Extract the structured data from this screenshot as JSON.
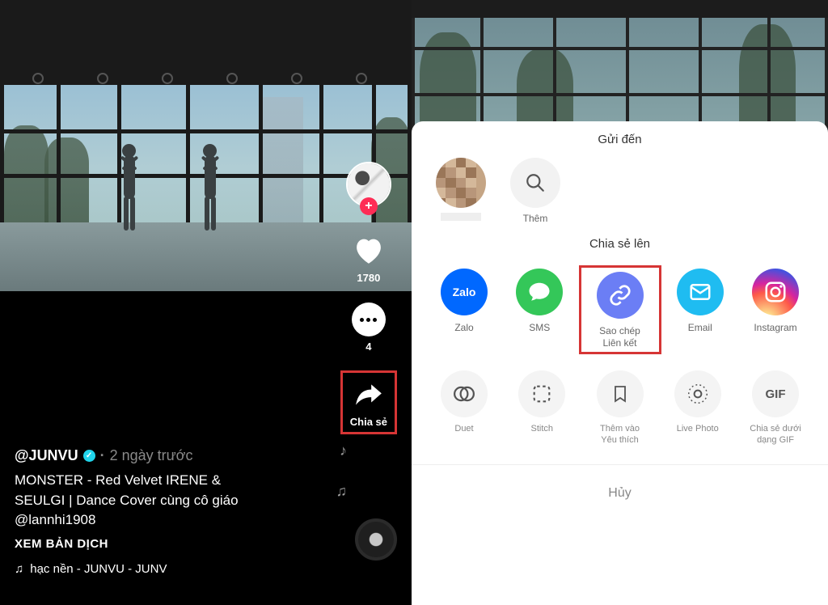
{
  "left": {
    "likes": "1780",
    "comments": "4",
    "share_label": "Chia sẻ",
    "username": "@JUNVU",
    "timeago": "2 ngày trước",
    "caption_l1": "MONSTER - Red Velvet IRENE &",
    "caption_l2": "SEULGI | Dance Cover cùng cô giáo",
    "mention": "@lannhi1908",
    "translate": "XEM BẢN DỊCH",
    "sound": "hạc nền - JUNVU - JUNV"
  },
  "sheet": {
    "send_to": "Gửi đến",
    "more": "Thêm",
    "share_to": "Chia sẻ lên",
    "share_items": {
      "zalo": "Zalo",
      "sms": "SMS",
      "copy_l1": "Sao chép",
      "copy_l2": "Liên kết",
      "email": "Email",
      "instagram": "Instagram"
    },
    "tools": {
      "duet": "Duet",
      "stitch": "Stitch",
      "fav_l1": "Thêm vào",
      "fav_l2": "Yêu thích",
      "live_photo": "Live Photo",
      "gif_l1": "Chia sẻ dưới",
      "gif_l2": "dạng GIF",
      "gif_glyph": "GIF"
    },
    "cancel": "Hủy"
  }
}
